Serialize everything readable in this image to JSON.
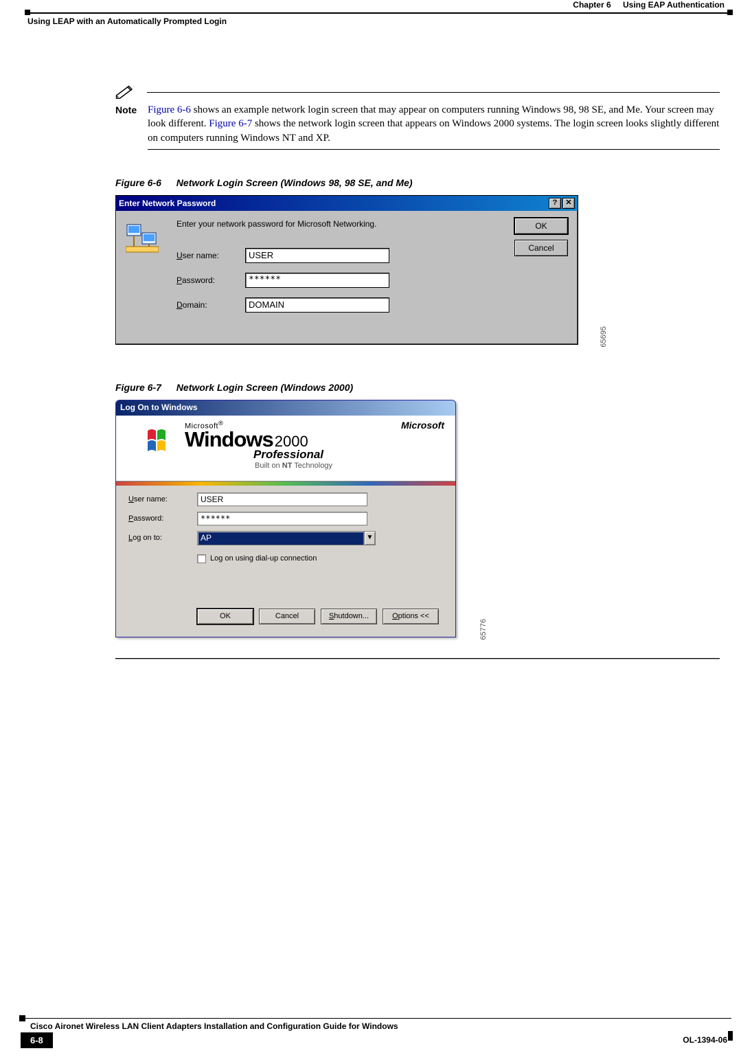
{
  "header": {
    "chapter_num": "Chapter 6",
    "chapter_title": "Using EAP Authentication",
    "section_title": "Using LEAP with an Automatically Prompted Login"
  },
  "note": {
    "label": "Note",
    "xref1": "Figure 6-6",
    "body1": " shows an example network login screen that may appear on computers running Windows 98, 98 SE, and Me. Your screen may look different. ",
    "xref2": "Figure 6-7",
    "body2": " shows the network login screen that appears on Windows 2000 systems. The login screen looks slightly different on computers running Windows NT and XP."
  },
  "figure6": {
    "caption_num": "Figure 6-6",
    "caption_text": "Network Login Screen (Windows 98, 98 SE, and Me)",
    "image_id": "65695",
    "dialog": {
      "title": "Enter Network Password",
      "help_btn": "?",
      "close_btn": "✕",
      "prompt": "Enter your network password for Microsoft Networking.",
      "user_label_u": "U",
      "user_label_rest": "ser name:",
      "user_value": "USER",
      "pass_label_u": "P",
      "pass_label_rest": "assword:",
      "pass_value": "******",
      "domain_label_u": "D",
      "domain_label_rest": "omain:",
      "domain_value": "DOMAIN",
      "ok": "OK",
      "cancel": "Cancel"
    }
  },
  "figure7": {
    "caption_num": "Figure 6-7",
    "caption_text": "Network Login Screen (Windows 2000)",
    "image_id": "65776",
    "dialog": {
      "title": "Log On to Windows",
      "banner_ms1": "Microsoft",
      "banner_ms1_sup": "®",
      "banner_win": "Windows",
      "banner_2000": "2000",
      "banner_pro": "Professional",
      "banner_built_pre": "Built on ",
      "banner_built_nt": "NT",
      "banner_built_post": " Technology",
      "banner_ms_right": "Microsoft",
      "user_label_u": "U",
      "user_label_rest": "ser name:",
      "user_value": "USER",
      "pass_label_u": "P",
      "pass_label_rest": "assword:",
      "pass_value": "******",
      "logon_label_u": "L",
      "logon_label_rest": "og on to:",
      "logon_value": "AP",
      "dialup_pre": "Log on using ",
      "dialup_u": "d",
      "dialup_post": "ial-up connection",
      "ok": "OK",
      "cancel": "Cancel",
      "shutdown_pre": "",
      "shutdown_u": "S",
      "shutdown_post": "hutdown...",
      "options_pre": "",
      "options_u": "O",
      "options_post": "ptions <<"
    }
  },
  "footer": {
    "book_title": "Cisco Aironet Wireless LAN Client Adapters Installation and Configuration Guide for Windows",
    "page_num": "6-8",
    "doc_num": "OL-1394-06"
  }
}
